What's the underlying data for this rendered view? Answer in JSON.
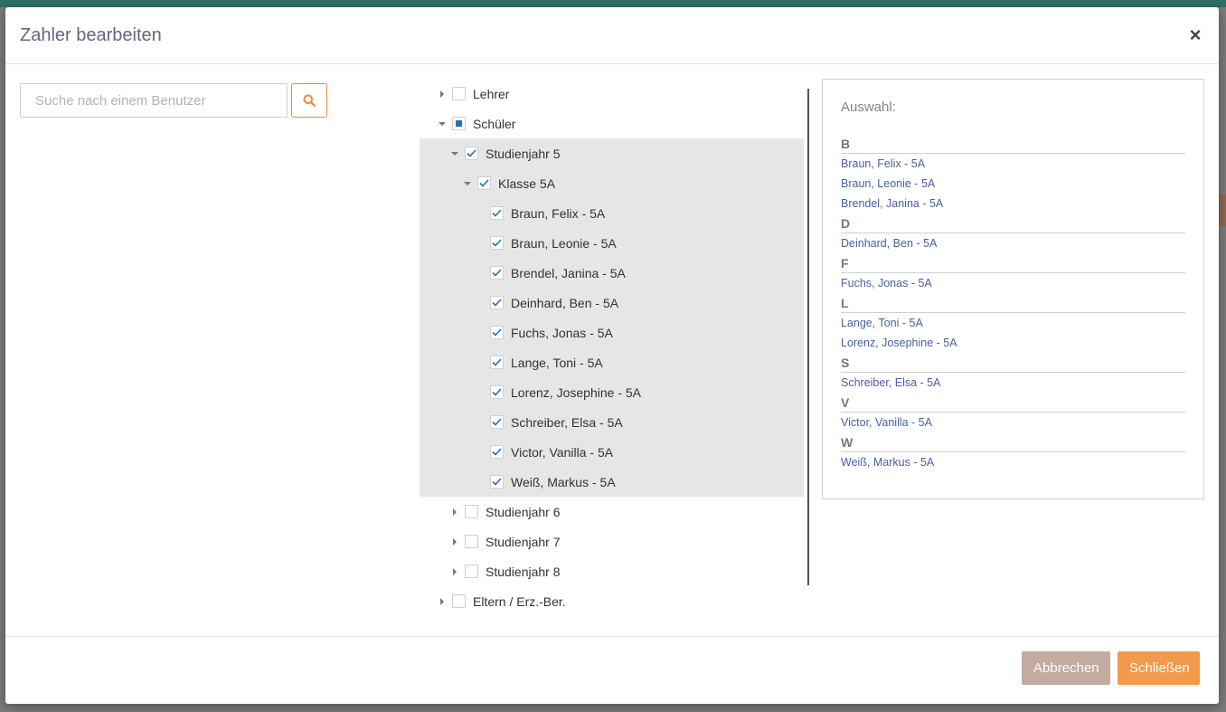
{
  "colors": {
    "accent": "#f0883a",
    "link": "#4a5fa3",
    "checkbox": "#2a6db0",
    "selected_bg": "#e6e6e6"
  },
  "modal": {
    "title": "Zahler bearbeiten",
    "close_icon": "close-icon"
  },
  "search": {
    "placeholder": "Suche nach einem Benutzer",
    "value": "",
    "button_icon": "search-icon"
  },
  "tree": {
    "lehrer": {
      "label": "Lehrer",
      "expanded": false,
      "checked": "unchecked"
    },
    "schueler": {
      "label": "Schüler",
      "expanded": true,
      "checked": "partial"
    },
    "studienjahr5": {
      "label": "Studienjahr 5",
      "expanded": true,
      "checked": "checked"
    },
    "klasse5a": {
      "label": "Klasse 5A",
      "expanded": true,
      "checked": "checked"
    },
    "students": [
      {
        "label": "Braun, Felix - 5A",
        "checked": "checked"
      },
      {
        "label": "Braun, Leonie - 5A",
        "checked": "checked"
      },
      {
        "label": "Brendel, Janina - 5A",
        "checked": "checked"
      },
      {
        "label": "Deinhard, Ben - 5A",
        "checked": "checked"
      },
      {
        "label": "Fuchs, Jonas - 5A",
        "checked": "checked"
      },
      {
        "label": "Lange, Toni - 5A",
        "checked": "checked"
      },
      {
        "label": "Lorenz, Josephine - 5A",
        "checked": "checked"
      },
      {
        "label": "Schreiber, Elsa - 5A",
        "checked": "checked"
      },
      {
        "label": "Victor, Vanilla - 5A",
        "checked": "checked"
      },
      {
        "label": "Weiß, Markus - 5A",
        "checked": "checked"
      }
    ],
    "studienjahr6": {
      "label": "Studienjahr 6",
      "expanded": false,
      "checked": "unchecked"
    },
    "studienjahr7": {
      "label": "Studienjahr 7",
      "expanded": false,
      "checked": "unchecked"
    },
    "studienjahr8": {
      "label": "Studienjahr 8",
      "expanded": false,
      "checked": "unchecked"
    },
    "eltern": {
      "label": "Eltern / Erz.-Ber.",
      "expanded": false,
      "checked": "unchecked"
    }
  },
  "selection": {
    "heading": "Auswahl:",
    "groups": [
      {
        "letter": "B",
        "items": [
          "Braun, Felix - 5A",
          "Braun, Leonie - 5A",
          "Brendel, Janina - 5A"
        ]
      },
      {
        "letter": "D",
        "items": [
          "Deinhard, Ben - 5A"
        ]
      },
      {
        "letter": "F",
        "items": [
          "Fuchs, Jonas - 5A"
        ]
      },
      {
        "letter": "L",
        "items": [
          "Lange, Toni - 5A",
          "Lorenz, Josephine - 5A"
        ]
      },
      {
        "letter": "S",
        "items": [
          "Schreiber, Elsa - 5A"
        ]
      },
      {
        "letter": "V",
        "items": [
          "Victor, Vanilla - 5A"
        ]
      },
      {
        "letter": "W",
        "items": [
          "Weiß, Markus - 5A"
        ]
      }
    ]
  },
  "footer": {
    "cancel_label": "Abbrechen",
    "close_label": "Schließen"
  }
}
